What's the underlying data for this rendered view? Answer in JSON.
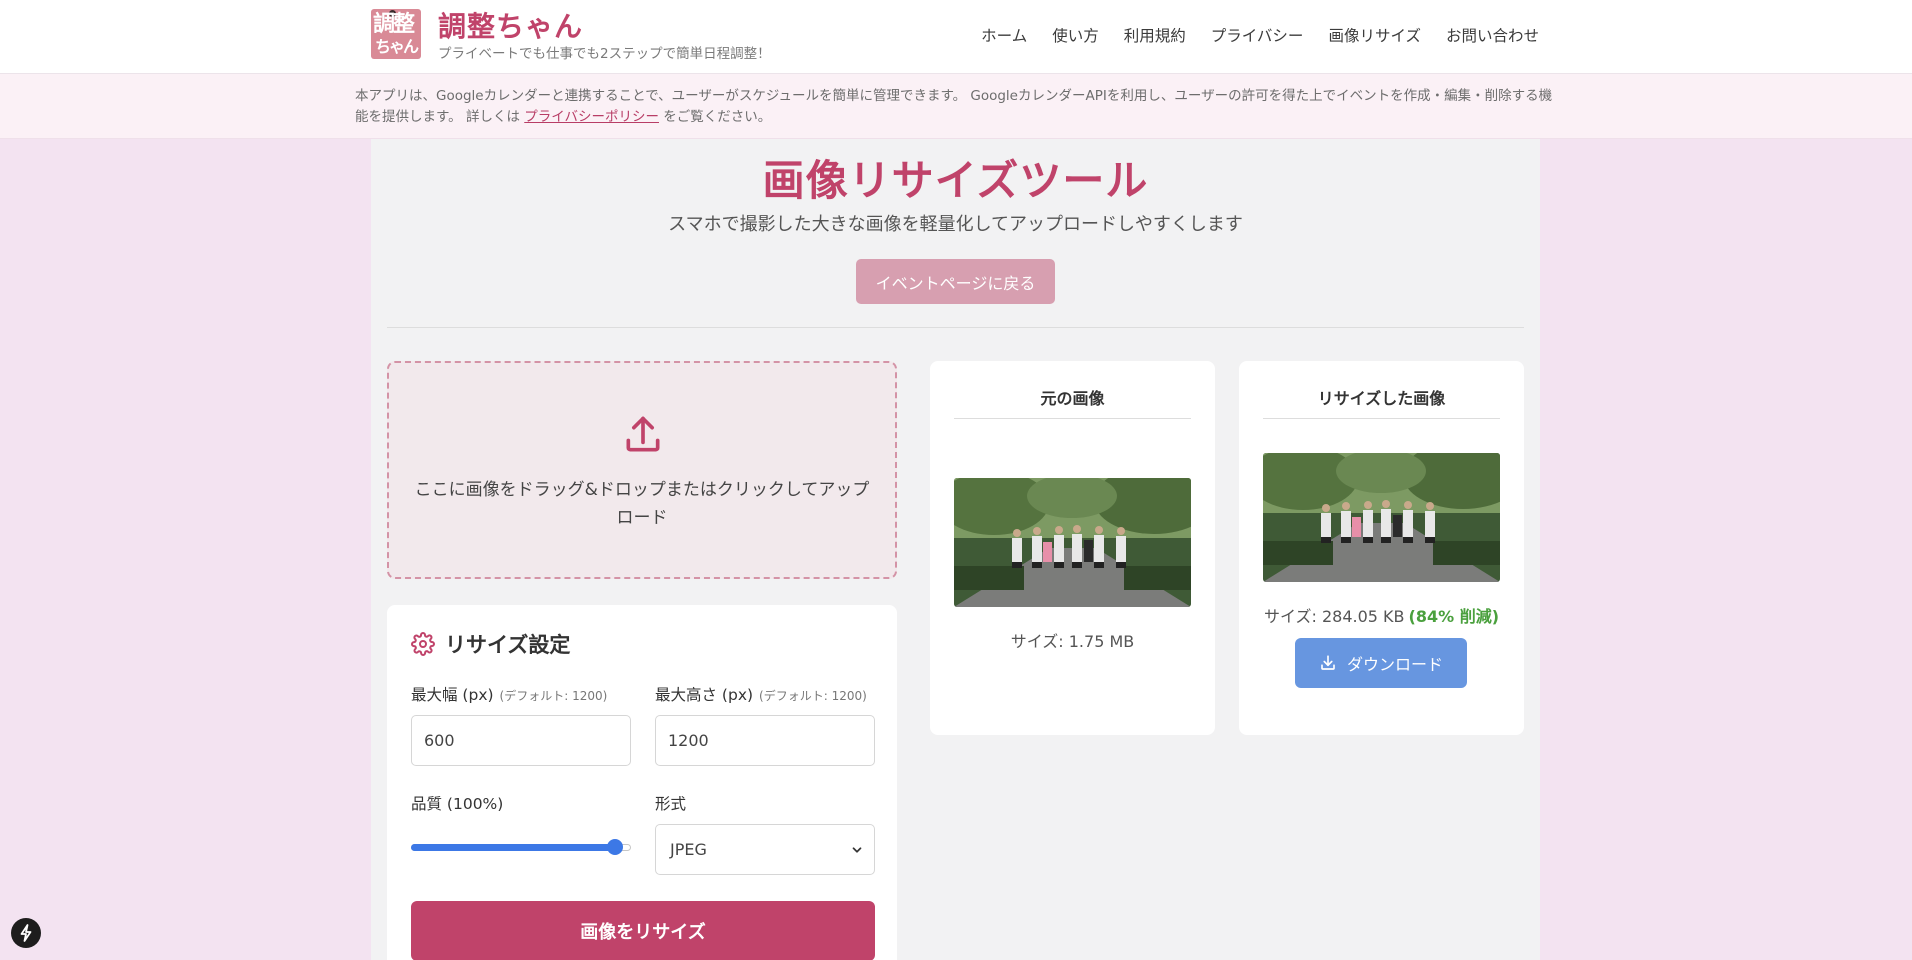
{
  "header": {
    "logo_text_1": "調整",
    "logo_text_2": "ちゃん",
    "title": "調整ちゃん",
    "subtitle": "プライベートでも仕事でも2ステップで簡単日程調整！",
    "nav": [
      "ホーム",
      "使い方",
      "利用規約",
      "プライバシー",
      "画像リサイズ",
      "お問い合わせ"
    ]
  },
  "notice": {
    "text_before": "本アプリは、Googleカレンダーと連携することで、ユーザーがスケジュールを簡単に管理できます。 GoogleカレンダーAPIを利用し、ユーザーの許可を得た上でイベントを作成・編集・削除する機能を提供します。 詳しくは",
    "link": "プライバシーポリシー",
    "text_after": "をご覧ください。"
  },
  "page": {
    "title": "画像リサイズツール",
    "subtitle": "スマホで撮影した大きな画像を軽量化してアップロードしやすくします",
    "back_button": "イベントページに戻る"
  },
  "dropzone": {
    "text": "ここに画像をドラッグ&ドロップまたはクリックしてアップロード",
    "icon": "upload-icon"
  },
  "settings": {
    "title": "リサイズ設定",
    "icon": "gear-icon",
    "max_width_label": "最大幅 (px)",
    "max_width_hint": "(デフォルト: 1200)",
    "max_width_value": "600",
    "max_height_label": "最大高さ (px)",
    "max_height_hint": "(デフォルト: 1200)",
    "max_height_value": "1200",
    "quality_label": "品質 (100%)",
    "quality_value": 1.0,
    "format_label": "形式",
    "format_value": "JPEG",
    "resize_button": "画像をリサイズ"
  },
  "original": {
    "title": "元の画像",
    "size": "サイズ: 1.75 MB"
  },
  "resized": {
    "title": "リサイズした画像",
    "size": "サイズ: 284.05 KB",
    "saving": "(84% 削減)",
    "download_button": "ダウンロード"
  },
  "colors": {
    "brand": "#c0436a",
    "download": "#6796e0",
    "saving": "#4aa03d"
  }
}
